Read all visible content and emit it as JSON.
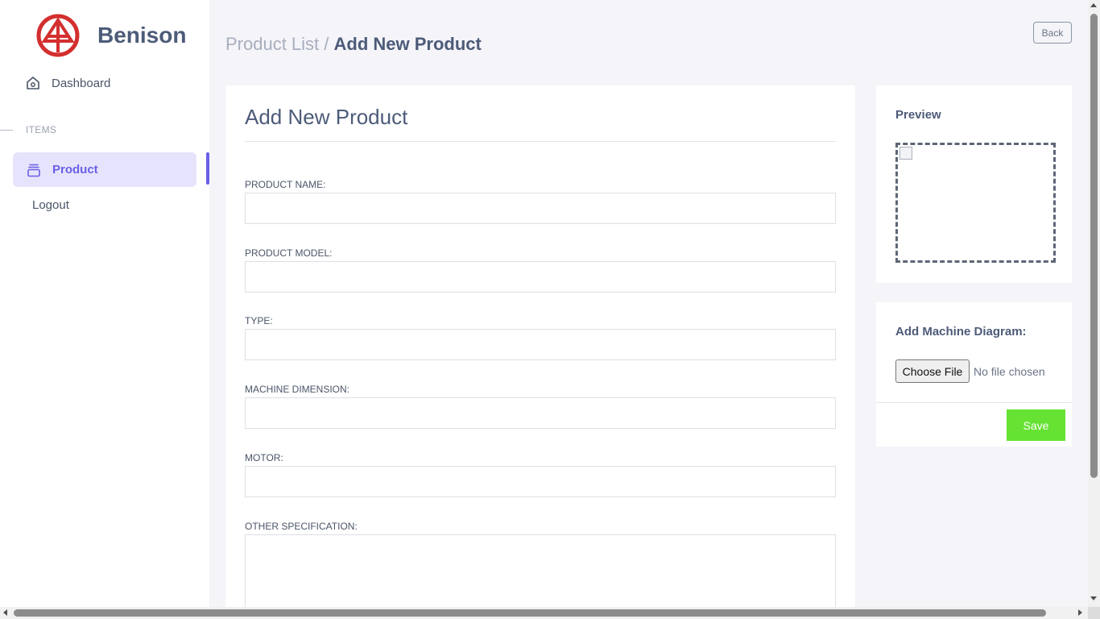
{
  "brand": {
    "name": "Benison",
    "logo_icon": "benison-logo-icon",
    "logo_color": "#d32f2f"
  },
  "sidebar": {
    "dashboard_label": "Dashboard",
    "dashboard_icon": "home-icon",
    "section_label": "ITEMS",
    "product_label": "Product",
    "product_icon": "layers-icon",
    "logout_label": "Logout",
    "active_color": "#6a5fe6"
  },
  "header": {
    "breadcrumb_parent": "Product List",
    "breadcrumb_separator": " / ",
    "breadcrumb_current": "Add New Product",
    "back_label": "Back"
  },
  "form": {
    "title": "Add New Product",
    "fields": [
      {
        "label": "PRODUCT NAME:",
        "value": ""
      },
      {
        "label": "PRODUCT MODEL:",
        "value": ""
      },
      {
        "label": "TYPE:",
        "value": ""
      },
      {
        "label": "MACHINE DIMENSION:",
        "value": ""
      },
      {
        "label": "MOTOR:",
        "value": ""
      },
      {
        "label": "OTHER SPECIFICATION:",
        "value": ""
      }
    ]
  },
  "preview": {
    "title": "Preview"
  },
  "upload": {
    "title": "Add Machine Diagram:",
    "choose_label": "Choose File",
    "status": "No file chosen",
    "save_label": "Save",
    "save_color": "#66e233"
  }
}
